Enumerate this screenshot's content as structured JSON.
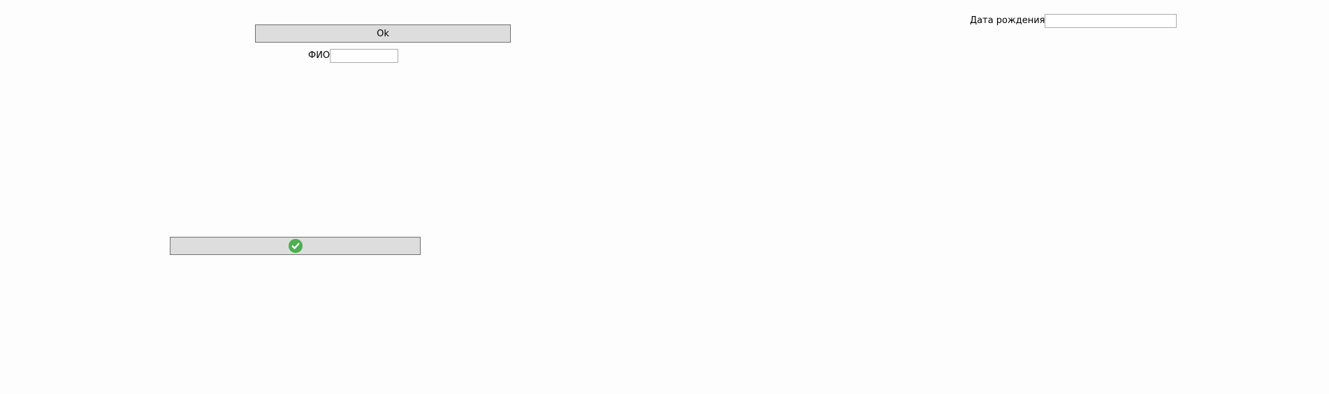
{
  "form": {
    "ok_button_label": "Ok",
    "fio_label": "ФИО",
    "fio_value": "",
    "dob_label": "Дата рождения",
    "dob_value": "",
    "confirm_button_icon": "check-circle-icon",
    "confirm_icon_color": "#4caf50"
  }
}
